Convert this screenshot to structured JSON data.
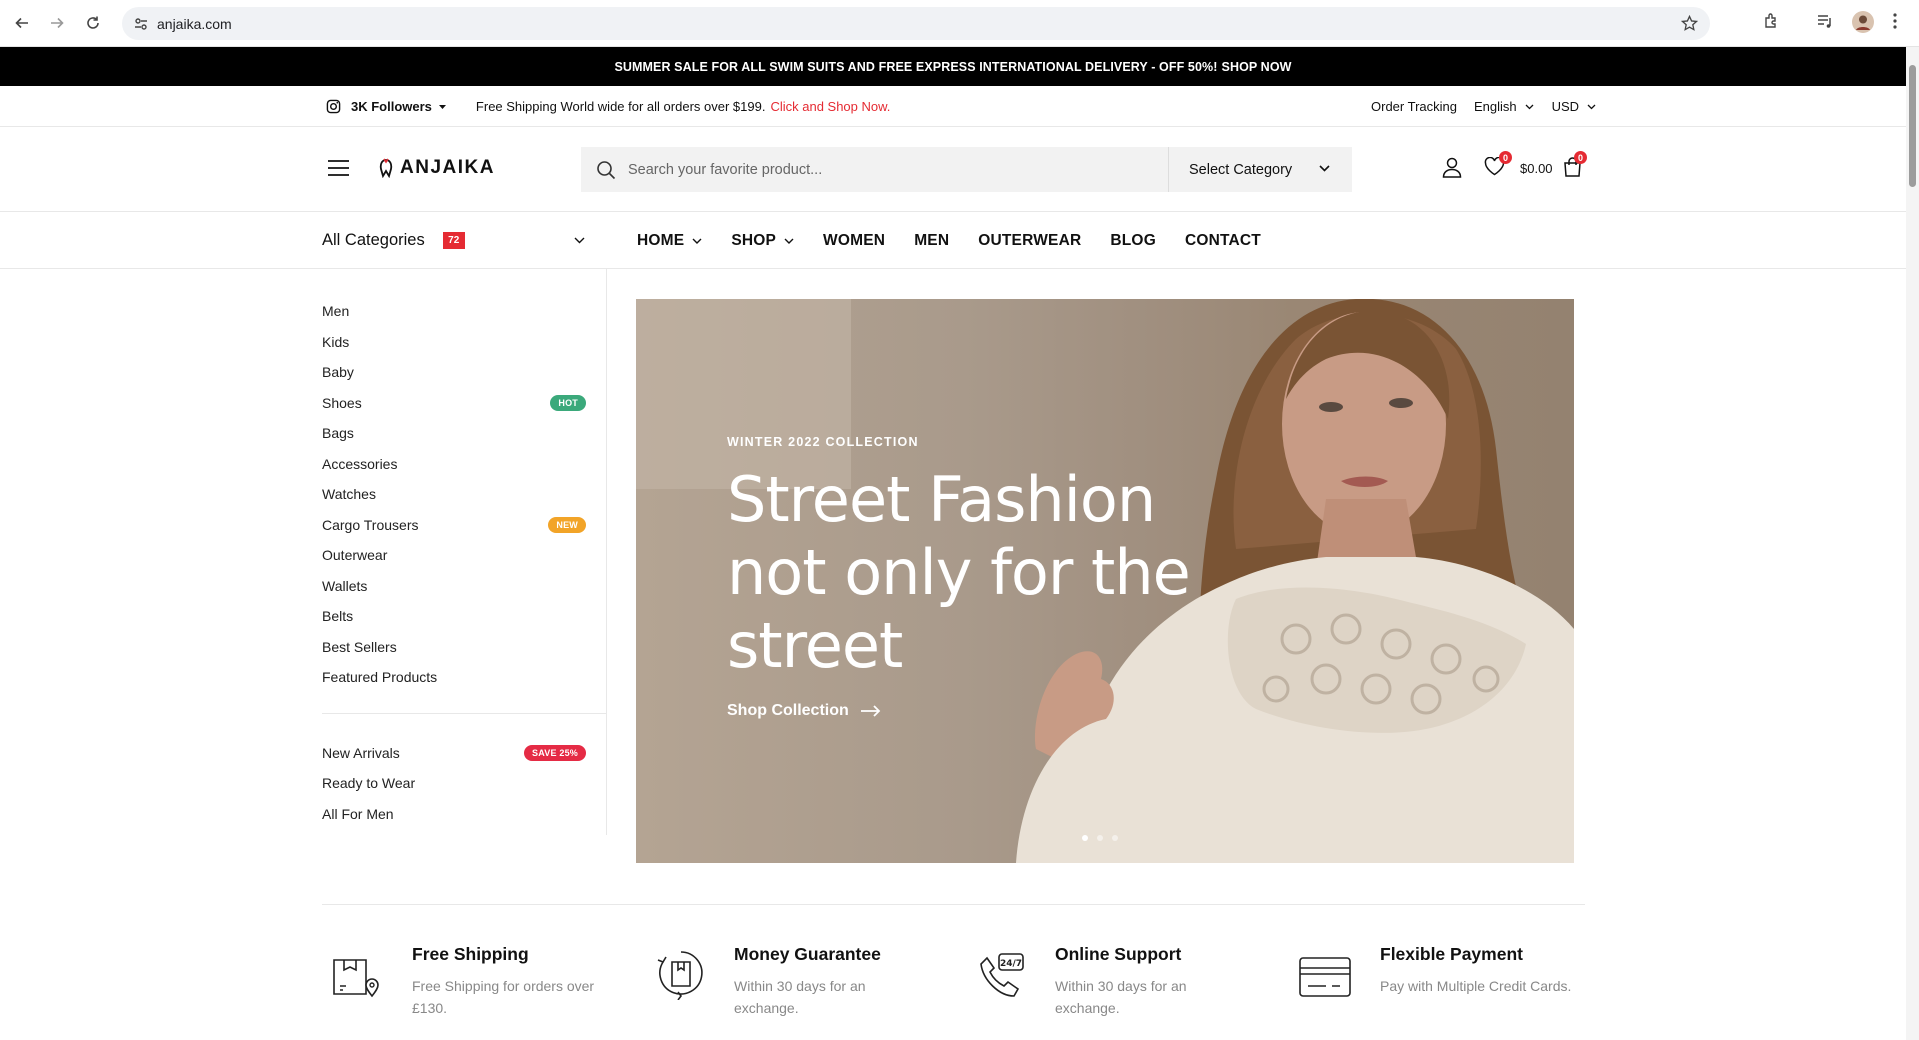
{
  "browser": {
    "url": "anjaika.com"
  },
  "announcement": {
    "text": "SUMMER SALE FOR ALL SWIM SUITS AND FREE EXPRESS INTERNATIONAL DELIVERY - OFF 50%!",
    "link": "SHOP NOW"
  },
  "topbar": {
    "followers": "3K Followers",
    "shipping_text": "Free Shipping World wide for all orders over $199.",
    "shipping_link": "Click and Shop Now.",
    "order_tracking": "Order Tracking",
    "language": "English",
    "currency": "USD"
  },
  "header": {
    "logo": "ANJAIKA",
    "search_placeholder": "Search your favorite product...",
    "category_select": "Select Category",
    "wishlist_count": "0",
    "cart_total": "$0.00",
    "cart_count": "0"
  },
  "nav": {
    "all_categories": "All Categories",
    "category_count": "72",
    "items": [
      {
        "label": "HOME"
      },
      {
        "label": "SHOP"
      },
      {
        "label": "WOMEN"
      },
      {
        "label": "MEN"
      },
      {
        "label": "OUTERWEAR"
      },
      {
        "label": "BLOG"
      },
      {
        "label": "CONTACT"
      }
    ]
  },
  "sidebar": {
    "categories": [
      {
        "label": "Men"
      },
      {
        "label": "Kids"
      },
      {
        "label": "Baby"
      },
      {
        "label": "Shoes",
        "tag": "HOT"
      },
      {
        "label": "Bags"
      },
      {
        "label": "Accessories"
      },
      {
        "label": "Watches"
      },
      {
        "label": "Cargo Trousers",
        "tag": "NEW"
      },
      {
        "label": "Outerwear"
      },
      {
        "label": "Wallets"
      },
      {
        "label": "Belts"
      },
      {
        "label": "Best Sellers"
      },
      {
        "label": "Featured Products"
      }
    ],
    "extra": [
      {
        "label": "New Arrivals",
        "tag": "SAVE 25%"
      },
      {
        "label": "Ready to Wear"
      },
      {
        "label": "All For Men"
      }
    ],
    "tag_colors": {
      "HOT": "#3ba97b",
      "NEW": "#f2a428",
      "SAVE 25%": "#e52b45"
    }
  },
  "hero": {
    "subtitle": "WINTER 2022 COLLECTION",
    "title": "Street Fashion not only for the street",
    "cta": "Shop Collection"
  },
  "features": [
    {
      "title": "Free Shipping",
      "desc": "Free Shipping for orders over £130.",
      "icon": "shipping-box-icon"
    },
    {
      "title": "Money Guarantee",
      "desc": "Within 30 days for an exchange.",
      "icon": "money-guarantee-icon"
    },
    {
      "title": "Online Support",
      "desc": "Within 30 days for an exchange.",
      "icon": "support-phone-icon"
    },
    {
      "title": "Flexible Payment",
      "desc": "Pay with Multiple Credit Cards.",
      "icon": "credit-card-icon"
    }
  ],
  "colors": {
    "accent": "#e52b33",
    "dark": "#000000"
  }
}
